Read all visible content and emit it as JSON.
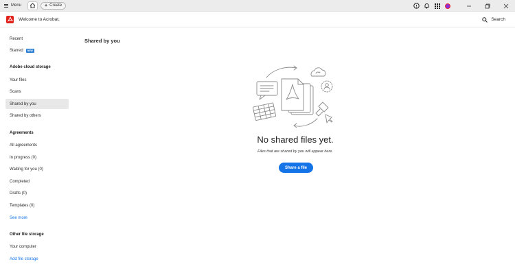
{
  "titlebar": {
    "menu_label": "Menu",
    "create_label": "Create",
    "window_controls": [
      "minimize-icon",
      "restore-icon",
      "close-icon"
    ]
  },
  "appbar": {
    "welcome": "Welcome to Acrobat,",
    "search_label": "Search"
  },
  "sidebar": {
    "recent": "Recent",
    "starred": "Starred",
    "starred_badge": "NEW",
    "cloud_heading": "Adobe cloud storage",
    "your_files": "Your files",
    "scans": "Scans",
    "shared_by_you": "Shared by you",
    "shared_by_others": "Shared by others",
    "agreements_heading": "Agreements",
    "all_agreements": "All agreements",
    "in_progress": "In progress (0)",
    "waiting_for_you": "Waiting for you (0)",
    "completed": "Completed",
    "drafts": "Drafts (0)",
    "templates": "Templates (0)",
    "see_more": "See more",
    "other_heading": "Other file storage",
    "your_computer": "Your computer",
    "add_file_storage": "Add file storage"
  },
  "main": {
    "title": "Shared by you",
    "empty_title": "No shared files yet.",
    "empty_subtitle": "Files that are shared by you will appear here.",
    "share_button": "Share a file"
  },
  "colors": {
    "accent": "#1473e6",
    "brand_red": "#e0221b",
    "badge": "#2d7fd3"
  }
}
